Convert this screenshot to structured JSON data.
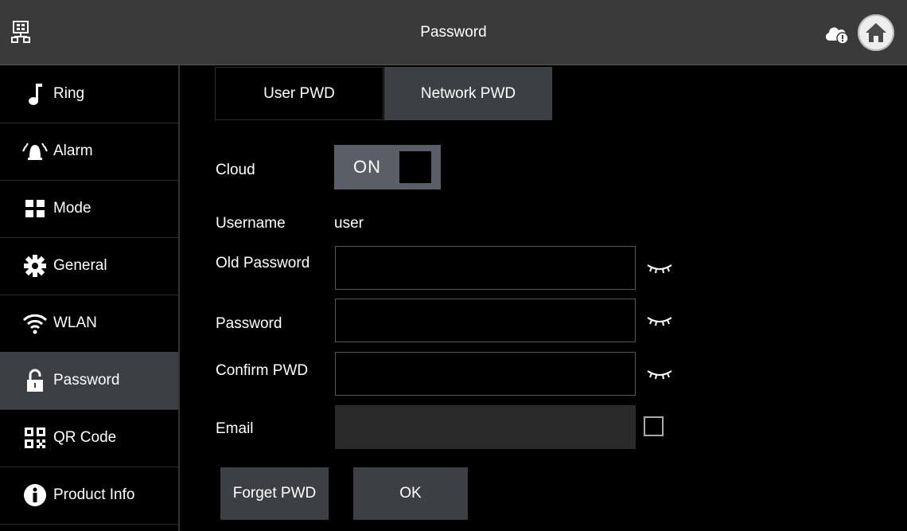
{
  "header": {
    "title": "Password",
    "left_icon": "network-icon",
    "right_icons": [
      "cloud-status-icon",
      "home-icon"
    ]
  },
  "sidebar": {
    "items": [
      {
        "label": "Ring",
        "icon": "music-note-icon",
        "active": false
      },
      {
        "label": "Alarm",
        "icon": "alarm-bell-icon",
        "active": false
      },
      {
        "label": "Mode",
        "icon": "mode-grid-icon",
        "active": false
      },
      {
        "label": "General",
        "icon": "gear-icon",
        "active": false
      },
      {
        "label": "WLAN",
        "icon": "wifi-icon",
        "active": false
      },
      {
        "label": "Password",
        "icon": "lock-icon",
        "active": true
      },
      {
        "label": "QR Code",
        "icon": "qr-code-icon",
        "active": false
      },
      {
        "label": "Product Info",
        "icon": "info-icon",
        "active": false
      }
    ]
  },
  "tabs": {
    "user": "User PWD",
    "network": "Network PWD",
    "active": "network"
  },
  "form": {
    "cloud_label": "Cloud",
    "cloud_toggle": "ON",
    "username_label": "Username",
    "username_value": "user",
    "old_password_label": "Old Password",
    "old_password_value": "",
    "password_label": "Password",
    "password_value": "",
    "confirm_label": "Confirm PWD",
    "confirm_value": "",
    "email_label": "Email",
    "email_value": ""
  },
  "buttons": {
    "forget": "Forget PWD",
    "ok": "OK"
  },
  "colors": {
    "header_bg": "#3a3a3a",
    "active_bg": "#3c3f44",
    "toggle_bg": "#5a5e66"
  }
}
